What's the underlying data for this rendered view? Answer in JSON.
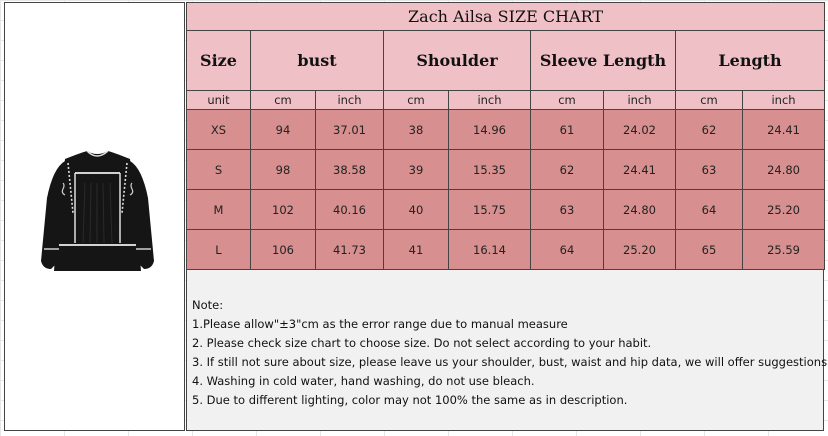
{
  "chart_title": "Zach Ailsa  SIZE CHART",
  "headers": {
    "size": "Size",
    "bust": "bust",
    "shoulder": "Shoulder",
    "sleeve": "Sleeve Length",
    "length": "Length"
  },
  "units": [
    "unit",
    "cm",
    "inch",
    "cm",
    "inch",
    "cm",
    "inch",
    "cm",
    "inch"
  ],
  "rows": [
    [
      "XS",
      "94",
      "37.01",
      "38",
      "14.96",
      "61",
      "24.02",
      "62",
      "24.41"
    ],
    [
      "S",
      "98",
      "38.58",
      "39",
      "15.35",
      "62",
      "24.41",
      "63",
      "24.80"
    ],
    [
      "M",
      "102",
      "40.16",
      "40",
      "15.75",
      "63",
      "24.80",
      "64",
      "25.20"
    ],
    [
      "L",
      "106",
      "41.73",
      "41",
      "16.14",
      "64",
      "25.20",
      "65",
      "25.59"
    ]
  ],
  "notes": [
    "Note:",
    "1.Please allow\"±3\"cm as the error range due to manual measure",
    "2. Please check size chart to choose size. Do not select according to your habit.",
    "3. If still not sure about size, please leave us your shoulder, bust, waist and hip data, we will offer suggestions.",
    "4. Washing in cold water, hand washing, do not use bleach.",
    "5. Due to different lighting, color may not 100% the same as in description."
  ],
  "colors": {
    "header_bg": "#efc1c7",
    "row_bg": "#d78f8f",
    "notes_bg": "#f1f1f1",
    "shirt": "#151515"
  },
  "image": {
    "subject": "black blouse with white trim"
  }
}
